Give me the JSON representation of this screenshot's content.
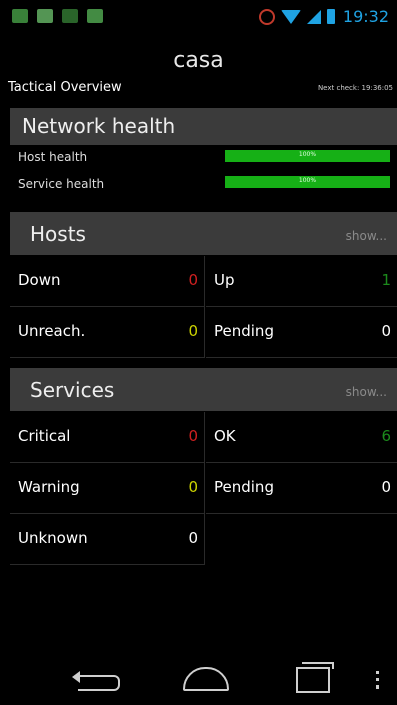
{
  "status_bar": {
    "left_icons": [
      "image-icon",
      "gallery-icon",
      "android-icon",
      "usb-icon"
    ],
    "right_icons": [
      "alarm-icon",
      "wifi-icon",
      "signal-icon",
      "battery-icon"
    ],
    "time": "19:32",
    "accent_color": "#1fa3e3"
  },
  "header": {
    "title": "casa",
    "subtitle": "Tactical Overview",
    "next_check": "Next check: 19:36:05"
  },
  "network_health": {
    "title": "Network health",
    "host_label": "Host health",
    "host_percent": "100%",
    "host_fraction": 1.0,
    "service_label": "Service health",
    "service_percent": "100%",
    "service_fraction": 1.0,
    "bar_color": "#16b016"
  },
  "hosts": {
    "title": "Hosts",
    "show_label": "show...",
    "down_label": "Down",
    "down_value": "0",
    "up_label": "Up",
    "up_value": "1",
    "unreach_label": "Unreach.",
    "unreach_value": "0",
    "pending_label": "Pending",
    "pending_value": "0"
  },
  "services": {
    "title": "Services",
    "show_label": "show...",
    "critical_label": "Critical",
    "critical_value": "0",
    "ok_label": "OK",
    "ok_value": "6",
    "warning_label": "Warning",
    "warning_value": "0",
    "pending_label": "Pending",
    "pending_value": "0",
    "unknown_label": "Unknown",
    "unknown_value": "0"
  },
  "nav_bar": {
    "buttons": [
      "back-icon",
      "home-icon",
      "recent-apps-icon",
      "menu-icon"
    ]
  }
}
